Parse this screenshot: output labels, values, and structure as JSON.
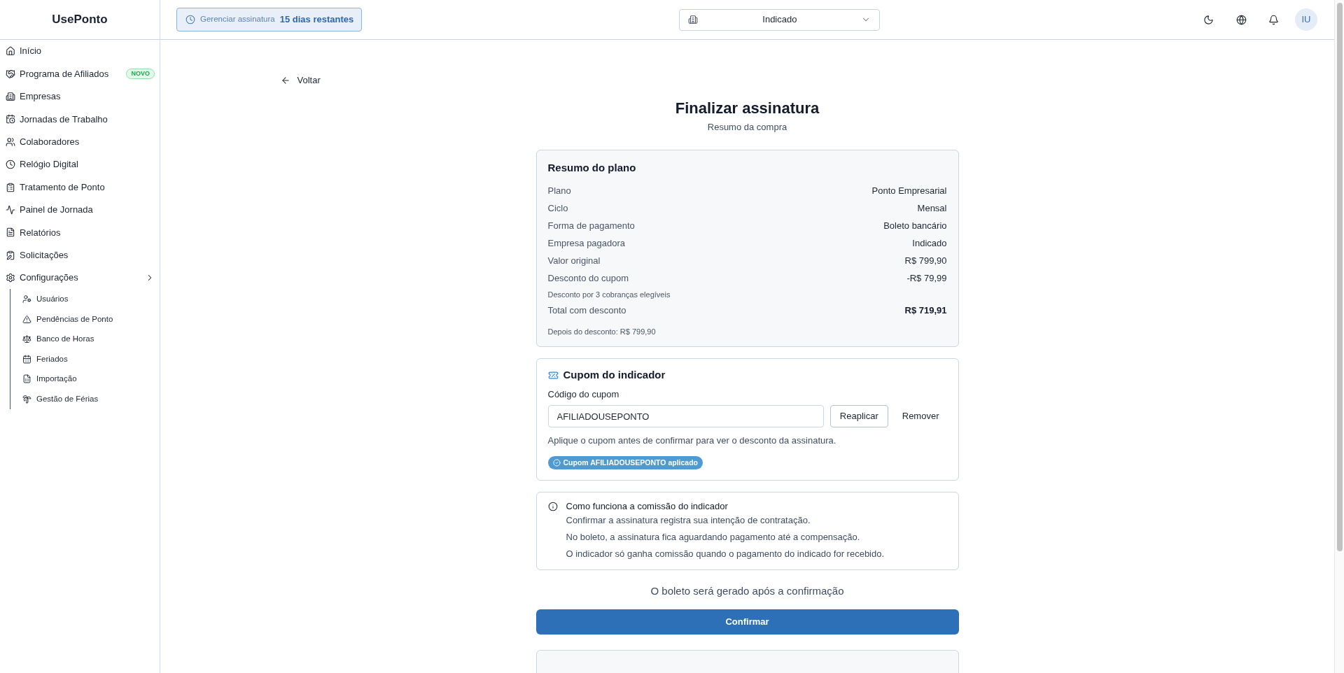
{
  "sidebar": {
    "logo": "UsePonto",
    "items": [
      {
        "label": "Início",
        "selected": false
      },
      {
        "label": "Programa de Afiliados",
        "selected": false,
        "badge": "NOVO"
      },
      {
        "label": "Empresas",
        "selected": false
      },
      {
        "label": "Jornadas de Trabalho",
        "selected": false
      },
      {
        "label": "Colaboradores",
        "selected": false
      },
      {
        "label": "Relógio Digital",
        "selected": false
      },
      {
        "label": "Tratamento de Ponto",
        "selected": false
      },
      {
        "label": "Painel de Jornada",
        "selected": false
      },
      {
        "label": "Relatórios",
        "selected": false
      },
      {
        "label": "Solicitações",
        "selected": false
      },
      {
        "label": "Configurações",
        "selected": false,
        "expanded": true,
        "children": [
          {
            "label": "Usuários",
            "selected": false
          },
          {
            "label": "Pendências de Ponto",
            "selected": false
          },
          {
            "label": "Banco de Horas",
            "selected": false
          },
          {
            "label": "Feriados",
            "selected": false
          },
          {
            "label": "Importação",
            "selected": false
          },
          {
            "label": "Gestão de Férias",
            "selected": false
          }
        ]
      }
    ]
  },
  "topbar": {
    "subscription": {
      "label": "Gerenciar assinatura",
      "remaining": "15 dias restantes"
    },
    "company_select": {
      "value": "Indicado"
    },
    "avatar": {
      "initials": "IU"
    }
  },
  "back_link": "Voltar",
  "header": {
    "title": "Finalizar assinatura",
    "subtitle": "Resumo da compra"
  },
  "plan_summary": {
    "title": "Resumo do plano",
    "rows": [
      {
        "kind": "row",
        "label": "Plano",
        "value": "Ponto Empresarial"
      },
      {
        "kind": "row",
        "label": "Ciclo",
        "value": "Mensal"
      },
      {
        "kind": "row",
        "label": "Forma de pagamento",
        "value": "Boleto bancário"
      },
      {
        "kind": "row",
        "label": "Empresa pagadora",
        "value": "Indicado"
      },
      {
        "kind": "row",
        "label": "Valor original",
        "value": "R$ 799,90"
      },
      {
        "kind": "row",
        "label": "Desconto do cupom",
        "value": "-R$ 79,99"
      },
      {
        "kind": "note",
        "label": "Desconto por 3 cobranças elegíveis"
      },
      {
        "kind": "total",
        "label": "Total com desconto",
        "value": "R$ 719,91"
      },
      {
        "kind": "footnote",
        "label": "Depois do desconto: R$ 799,90"
      }
    ]
  },
  "coupon": {
    "title": "Cupom do indicador",
    "field_label": "Código do cupom",
    "code": "AFILIADOUSEPONTO",
    "apply_button": "Reaplicar",
    "remove_button": "Remover",
    "hint": "Aplique o cupom antes de confirmar para ver o desconto da assinatura.",
    "applied_badge": "Cupom AFILIADOUSEPONTO aplicado"
  },
  "commission_info": {
    "title": "Como funciona a comissão do indicador",
    "lines": [
      "Confirmar a assinatura registra sua intenção de contratação.",
      "No boleto, a assinatura fica aguardando pagamento até a compensação.",
      "O indicador só ganha comissão quando o pagamento do indicado for recebido."
    ]
  },
  "payment_note": "O boleto será gerado após a confirmação",
  "confirm_button": "Confirmar"
}
